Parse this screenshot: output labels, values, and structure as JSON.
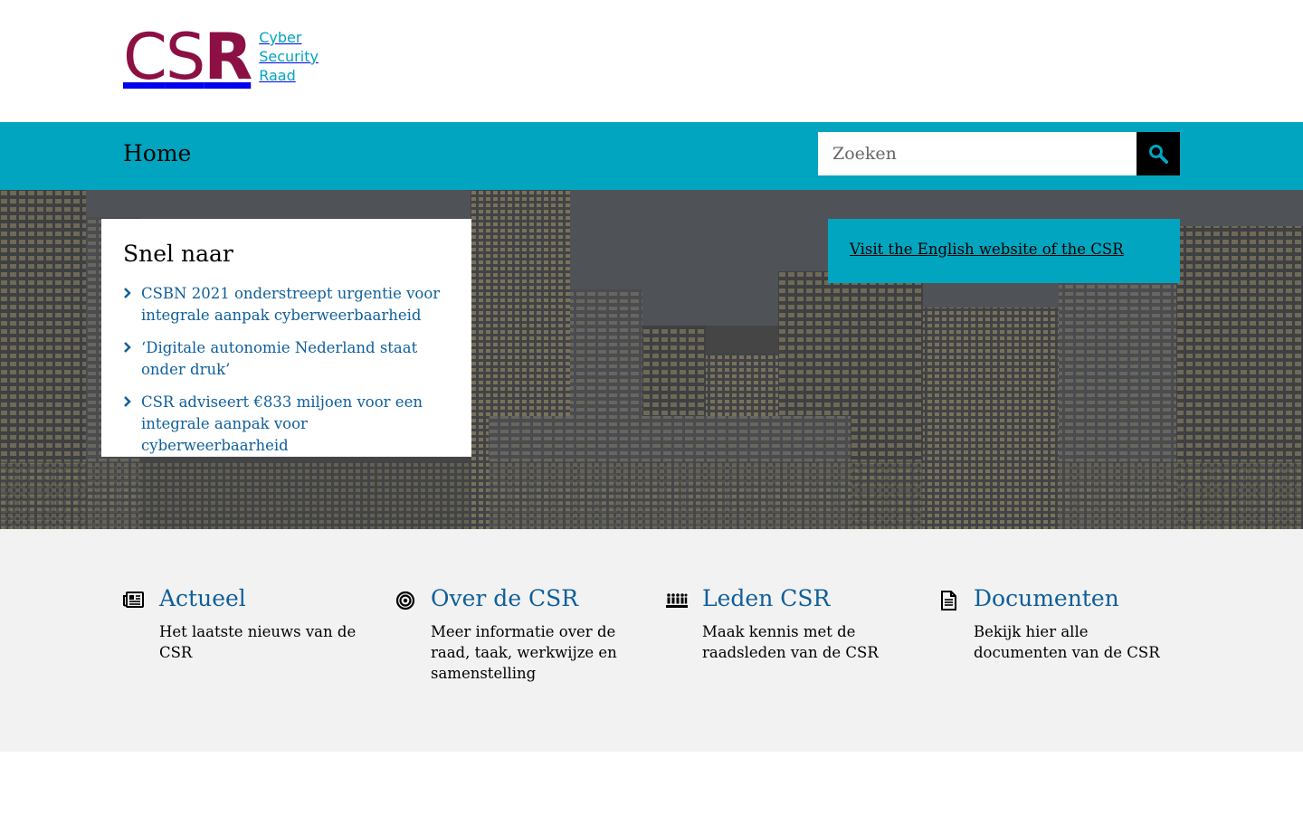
{
  "logo": {
    "mark_c": "C",
    "mark_s": "S",
    "mark_r": "R",
    "line1": "Cyber",
    "line2": "Security",
    "line3": "Raad",
    "colors": {
      "mark": "#8c1044",
      "text": "#00a4c0"
    }
  },
  "nav": {
    "home_label": "Home",
    "search_placeholder": "Zoeken",
    "search_icon": "search-icon",
    "bar_color": "#01a5bf"
  },
  "quicklinks": {
    "title": "Snel naar",
    "items": [
      {
        "label": "CSBN 2021 onderstreept urgentie voor integrale aanpak cyberweerbaarheid"
      },
      {
        "label": "‘Digitale autonomie Nederland staat onder druk’"
      },
      {
        "label": "CSR adviseert €833 miljoen voor een integrale aanpak voor cyberweerbaarheid"
      }
    ]
  },
  "english": {
    "link_label": "Visit the English website of the CSR"
  },
  "tiles": [
    {
      "icon": "newspaper-icon",
      "title": "Actueel",
      "description": "Het laatste nieuws van de CSR"
    },
    {
      "icon": "target-icon",
      "title": "Over de CSR",
      "description": "Meer informatie over de raad, taak, werkwijze en samenstelling"
    },
    {
      "icon": "people-icon",
      "title": "Leden CSR",
      "description": "Maak kennis met de raadsleden van de CSR"
    },
    {
      "icon": "document-icon",
      "title": "Documenten",
      "description": "Bekijk hier alle documenten van de CSR"
    }
  ],
  "colors": {
    "link": "#0f5f9a",
    "tiles_bg": "#f2f2f2"
  }
}
